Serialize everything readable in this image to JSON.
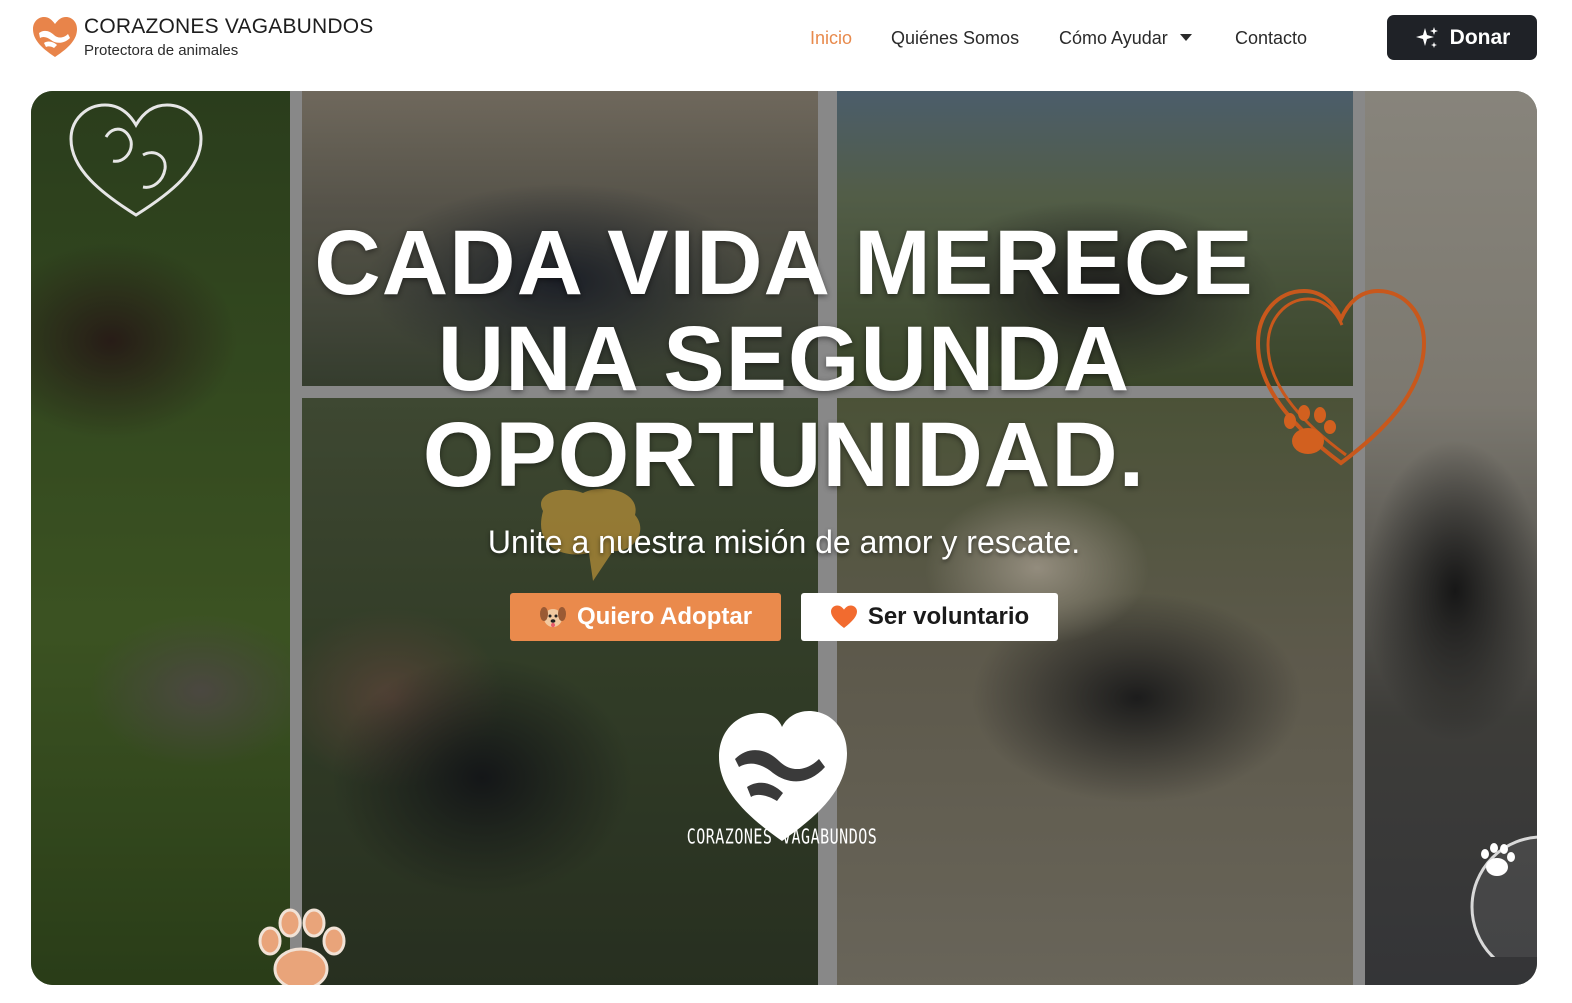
{
  "brand": {
    "name": "CORAZONES VAGABUNDOS",
    "tagline": "Protectora de animales",
    "logo_icon": "heart-hands-logo-icon",
    "accent_color": "#e88a4c"
  },
  "nav": {
    "items": [
      {
        "label": "Inicio",
        "active": true
      },
      {
        "label": "Quiénes Somos",
        "active": false
      },
      {
        "label": "Cómo Ayudar",
        "active": false,
        "dropdown": true
      },
      {
        "label": "Contacto",
        "active": false
      }
    ],
    "donate_label": "Donar",
    "donate_icon": "sparkle-icon",
    "donate_color": "#1f2227"
  },
  "hero": {
    "title_lines": [
      "CADA VIDA MERECE",
      "UNA SEGUNDA",
      "OPORTUNIDAD."
    ],
    "subtitle": "Unite a nuestra misión de amor y rescate.",
    "cta_adopt": {
      "label": "Quiero Adoptar",
      "icon": "dog-face-icon",
      "color": "#ea8a4c"
    },
    "cta_volunteer": {
      "label": "Ser voluntario",
      "icon": "orange-heart-icon"
    },
    "center_logo_text": "CORAZONES VAGABUNDOS"
  }
}
